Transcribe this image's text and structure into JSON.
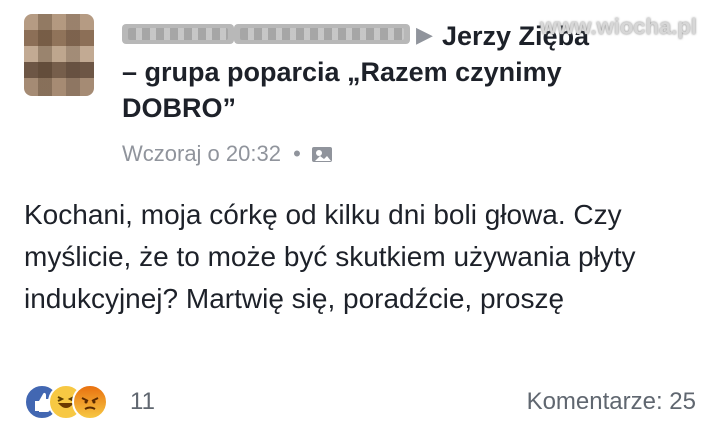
{
  "post": {
    "group_line_1": "Jerzy Zięba",
    "group_line_2": "– grupa poparcia „Razem czynimy DOBRO”",
    "timestamp": "Wczoraj o 20:32",
    "privacy_icon": "photo-icon",
    "body": "Kochani, moja córkę od kilku dni boli głowa. Czy myślicie, że to może być skutkiem używania płyty indukcyjnej? Martwię się, poradźcie, proszę"
  },
  "footer": {
    "reaction_count": "11",
    "comments_label": "Komentarze: 25",
    "reaction_icons": [
      "like-icon",
      "haha-icon",
      "angry-icon"
    ],
    "colors": {
      "like": "#4267b2",
      "haha": "#f7c843",
      "angry": "#e9710f"
    }
  },
  "watermark": "www.wiocha.pl"
}
